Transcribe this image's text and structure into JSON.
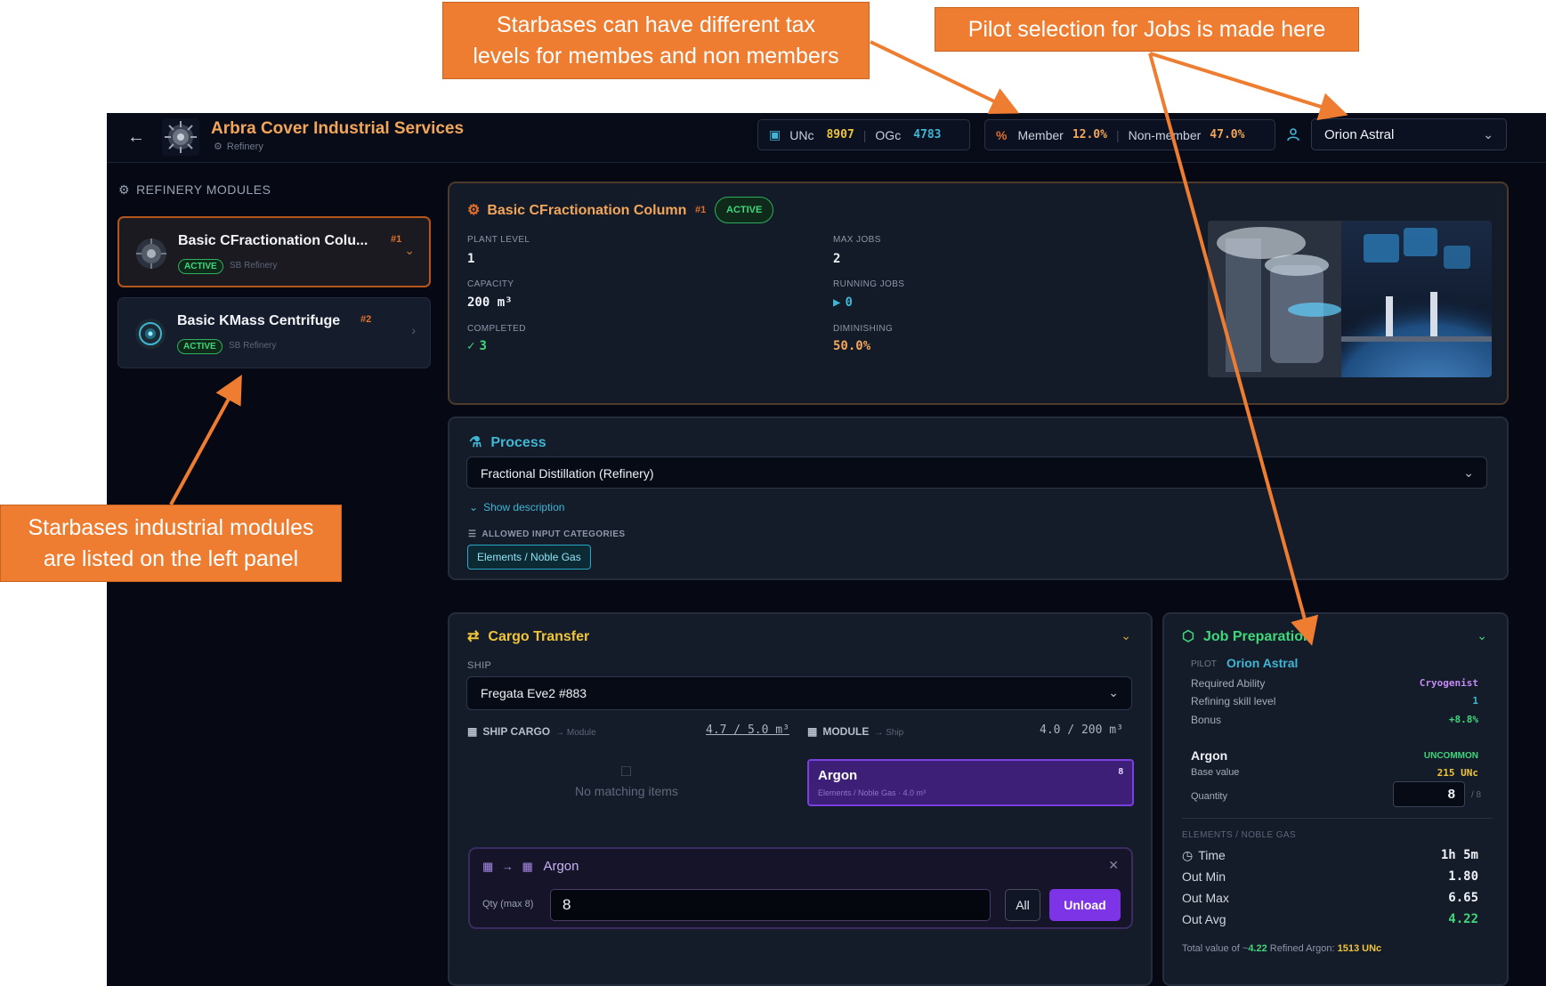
{
  "callouts": {
    "tax_line1": "Starbases can have different tax",
    "tax_line2": "levels for membes and non members",
    "pilot": "Pilot selection for Jobs is made here",
    "modules_line1": "Starbases industrial modules",
    "modules_line2": "are listed on the left panel"
  },
  "header": {
    "title": "Arbra Cover Industrial Services",
    "subtitle": "Refinery",
    "unc_label": "UNc",
    "unc_value": "8907",
    "ogc_label": "OGc",
    "ogc_value": "4783",
    "member_label": "Member",
    "member_value": "12.0%",
    "nonmember_label": "Non-member",
    "nonmember_value": "47.0%",
    "pilot_selected": "Orion Astral"
  },
  "sidebar": {
    "title": "REFINERY MODULES",
    "items": [
      {
        "name": "Basic CFractionation Colu...",
        "num": "#1",
        "status": "ACTIVE",
        "meta": "SB Refinery"
      },
      {
        "name": "Basic KMass Centrifuge",
        "num": "#2",
        "status": "ACTIVE",
        "meta": "SB Refinery"
      }
    ]
  },
  "module": {
    "title": "Basic CFractionation Column",
    "num": "#1",
    "status": "ACTIVE",
    "plant_level_label": "PLANT LEVEL",
    "plant_level": "1",
    "max_jobs_label": "MAX JOBS",
    "max_jobs": "2",
    "capacity_label": "CAPACITY",
    "capacity": "200 m³",
    "running_jobs_label": "RUNNING JOBS",
    "running_jobs": "0",
    "completed_label": "COMPLETED",
    "completed": "3",
    "diminishing_label": "DIMINISHING",
    "diminishing": "50.0%"
  },
  "process": {
    "title": "Process",
    "selected": "Fractional Distillation (Refinery)",
    "show_description": "Show description",
    "allowed_label": "ALLOWED INPUT CATEGORIES",
    "allowed_tag": "Elements / Noble Gas"
  },
  "cargo": {
    "title": "Cargo Transfer",
    "ship_label": "SHIP",
    "ship_selected": "Fregata Eve2 #883",
    "ship_cargo_label": "SHIP CARGO",
    "ship_cargo_hint": "→ Module",
    "ship_cargo_value": "4.7 / 5.0 m³",
    "module_label": "MODULE",
    "module_hint": "→ Ship",
    "module_value": "4.0 / 200 m³",
    "empty_text": "No matching items",
    "item_name": "Argon",
    "item_count": "8",
    "item_meta": "Elements / Noble Gas · 4.0 m³",
    "transfer_item": "Argon",
    "qty_label": "Qty (max 8)",
    "qty_value": "8",
    "all_label": "All",
    "unload_label": "Unload"
  },
  "job": {
    "title": "Job Preparation",
    "pilot_label": "PILOT",
    "pilot_name": "Orion Astral",
    "required_ability_label": "Required Ability",
    "required_ability": "Cryogenist",
    "skill_label": "Refining skill level",
    "skill_value": "1",
    "bonus_label": "Bonus",
    "bonus_value": "+8.8%",
    "item_name": "Argon",
    "rarity": "UNCOMMON",
    "base_value_label": "Base value",
    "base_value": "215 UNc",
    "quantity_label": "Quantity",
    "quantity_value": "8",
    "quantity_max": "/ 8",
    "category": "ELEMENTS / NOBLE GAS",
    "time_label": "Time",
    "time_value": "1h 5m",
    "out_min_label": "Out Min",
    "out_min": "1.80",
    "out_max_label": "Out Max",
    "out_max": "6.65",
    "out_avg_label": "Out Avg",
    "out_avg": "4.22",
    "total_prefix": "Total value of ~",
    "total_qty": "4.22",
    "total_mid": " Refined Argon: ",
    "total_value": "1513 UNc"
  },
  "colors": {
    "accent_orange": "#f2a65a",
    "active_green": "#3fd77a",
    "cyan": "#3fb6d4",
    "violet": "#7d33e6",
    "callout": "#ee7d31"
  }
}
